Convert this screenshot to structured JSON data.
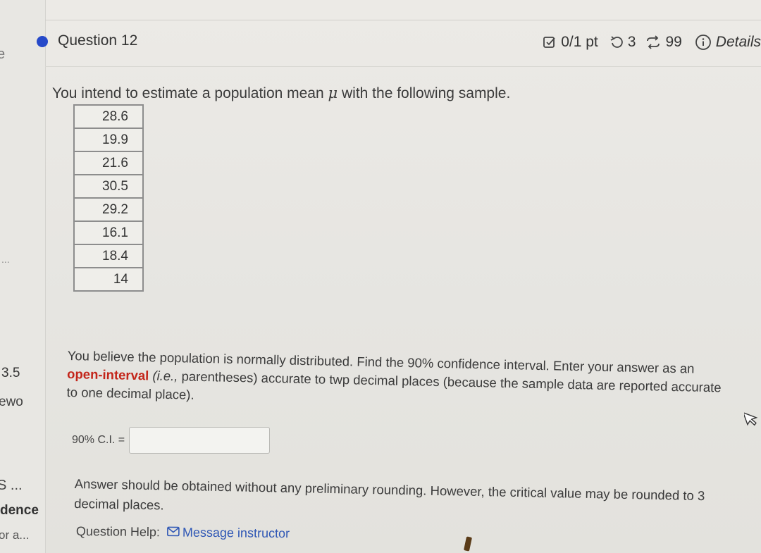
{
  "sidebar": {
    "frag_e": "e",
    "frag_dots": "...",
    "frag_number": "3.5",
    "frag_ewo": "ewo",
    "frag_s": "S ...",
    "frag_dence": "dence",
    "frag_ora": "or a..."
  },
  "header": {
    "title": "Question 12",
    "points": "0/1 pt",
    "tries": "3",
    "submissions": "99",
    "details": "Details"
  },
  "question": {
    "prompt_before": "You intend to estimate a population mean ",
    "mu": "μ",
    "prompt_after": " with the following sample.",
    "sample": [
      "28.6",
      "19.9",
      "21.6",
      "30.5",
      "29.2",
      "16.1",
      "18.4",
      "14"
    ],
    "instr_1": "You believe the population is normally distributed. Find the 90% confidence interval. Enter your answer as an ",
    "instr_open": "open-interval",
    "instr_ie": "(i.e.,",
    "instr_2": " parentheses) accurate to twp decimal places (because the sample data are reported accurate to one decimal place).",
    "ci_label": "90% C.I. =",
    "ci_value": "",
    "note": "Answer should be obtained without any preliminary rounding. However, the critical value may be rounded to 3 decimal places.",
    "help_label": "Question Help:",
    "message_link": "Message instructor"
  },
  "colors": {
    "accent_dot": "#2649c9",
    "open_interval": "#c3251a",
    "link": "#2f57b5"
  },
  "icons": {
    "points": "checkbox-icon",
    "tries": "retry-icon",
    "submissions": "resubmit-icon",
    "details": "info-icon",
    "message": "mail-icon",
    "cursor": "mouse-cursor-icon"
  }
}
